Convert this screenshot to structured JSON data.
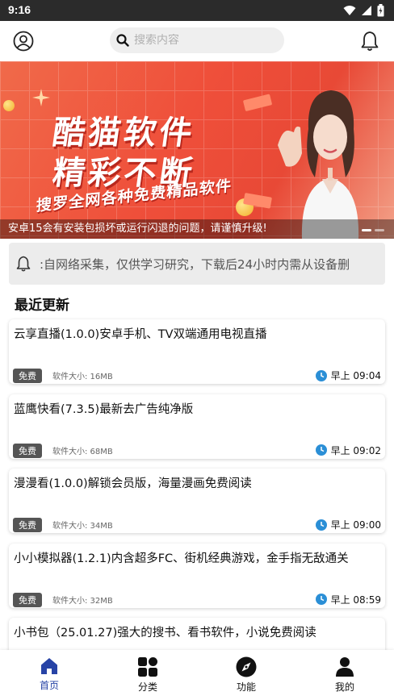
{
  "status_bar": {
    "time": "9:16"
  },
  "header": {
    "search_placeholder": "搜索内容",
    "icons": [
      "user-icon",
      "search-icon",
      "bell-icon"
    ]
  },
  "banner": {
    "title_line1": "酷猫软件",
    "title_line2": "精彩不断",
    "subtitle": "搜罗全网各种免费精品软件",
    "caption": "安卓15会有安装包损坏或运行闪退的问题，请谨慎升级!",
    "colors": {
      "background": "#ef4f3a",
      "text": "#ffffff"
    }
  },
  "notice": {
    "text": ":自网络采集，仅供学习研究，下载后24小时内需从设备删"
  },
  "section": {
    "title": "最近更新"
  },
  "items": [
    {
      "name": "云享直播(1.0.0)安卓手机、TV双端通用电视直播",
      "badge": "免费",
      "size": "软件大小: 16MB",
      "time": "早上 09:04"
    },
    {
      "name": "蓝鹰快看(7.3.5)最新去广告纯净版",
      "badge": "免费",
      "size": "软件大小: 68MB",
      "time": "早上 09:02"
    },
    {
      "name": "漫漫看(1.0.0)解锁会员版，海量漫画免费阅读",
      "badge": "免费",
      "size": "软件大小: 34MB",
      "time": "早上 09:00"
    },
    {
      "name": "小小模拟器(1.2.1)内含超多FC、街机经典游戏，金手指无敌通关",
      "badge": "免费",
      "size": "软件大小: 32MB",
      "time": "早上 08:59"
    },
    {
      "name": "小书包（25.01.27)强大的搜书、看书软件，小说免费阅读",
      "badge": "",
      "size": "",
      "time": ""
    }
  ],
  "bottom_nav": [
    {
      "label": "首页",
      "icon": "home-icon",
      "active": true
    },
    {
      "label": "分类",
      "icon": "grid-icon",
      "active": false
    },
    {
      "label": "功能",
      "icon": "compass-icon",
      "active": false
    },
    {
      "label": "我的",
      "icon": "person-icon",
      "active": false
    }
  ],
  "colors": {
    "accent": "#2743a6",
    "clock": "#2b8fd6",
    "badge": "#555555"
  }
}
